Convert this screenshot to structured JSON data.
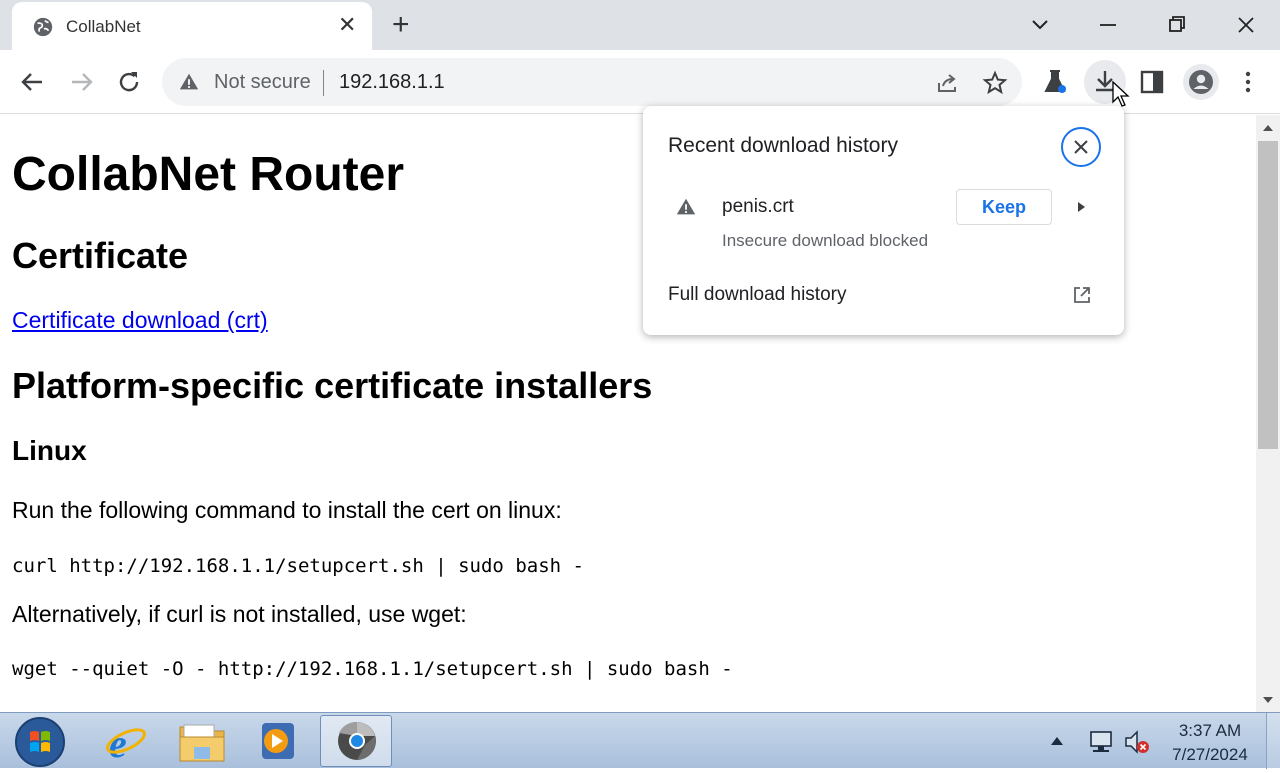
{
  "browser": {
    "tab_title": "CollabNet",
    "tab_close": "✕",
    "new_tab": "+",
    "omnibox": {
      "security_label": "Not secure",
      "url": "192.168.1.1"
    }
  },
  "page": {
    "title": "CollabNet Router",
    "section_certificate": "Certificate",
    "certificate_link": "Certificate download (crt)",
    "section_installers": "Platform-specific certificate installers",
    "subsection_linux": "Linux",
    "linux_instruction": "Run the following command to install the cert on linux:",
    "linux_command_curl": "curl http://192.168.1.1/setupcert.sh | sudo bash -",
    "linux_alt_instruction": "Alternatively, if curl is not installed, use wget:",
    "linux_command_wget": "wget --quiet -O - http://192.168.1.1/setupcert.sh | sudo bash -"
  },
  "download_popup": {
    "title": "Recent download history",
    "item": {
      "filename": "penis.crt",
      "status": "Insecure download blocked",
      "keep_label": "Keep"
    },
    "full_history_label": "Full download history"
  },
  "taskbar": {
    "clock_time": "3:37 AM",
    "clock_date": "7/27/2024"
  },
  "icons": {
    "tab": "globe-icon",
    "window_controls": [
      "chevron-down-icon",
      "minimize-icon",
      "restore-icon",
      "close-icon"
    ],
    "toolbar": [
      "back-arrow-icon",
      "forward-arrow-icon",
      "reload-icon",
      "warning-icon",
      "share-icon",
      "star-icon",
      "labs-flask-icon",
      "download-icon",
      "side-panel-icon",
      "profile-icon",
      "more-menu-icon"
    ],
    "popup": [
      "close-circle-icon",
      "warning-icon",
      "play-arrow-icon",
      "open-external-icon"
    ],
    "taskbar": [
      "windows-start-icon",
      "internet-explorer-icon",
      "file-explorer-icon",
      "media-player-icon",
      "chrome-icon",
      "tray-up-arrow-icon",
      "network-icon",
      "volume-muted-icon"
    ]
  },
  "colors": {
    "tabstrip_bg": "#dee1e6",
    "omnibox_bg": "#f1f3f4",
    "accent_blue": "#1a73e8",
    "link": "#0000ee",
    "taskbar_bg": "#b6cbe3"
  }
}
